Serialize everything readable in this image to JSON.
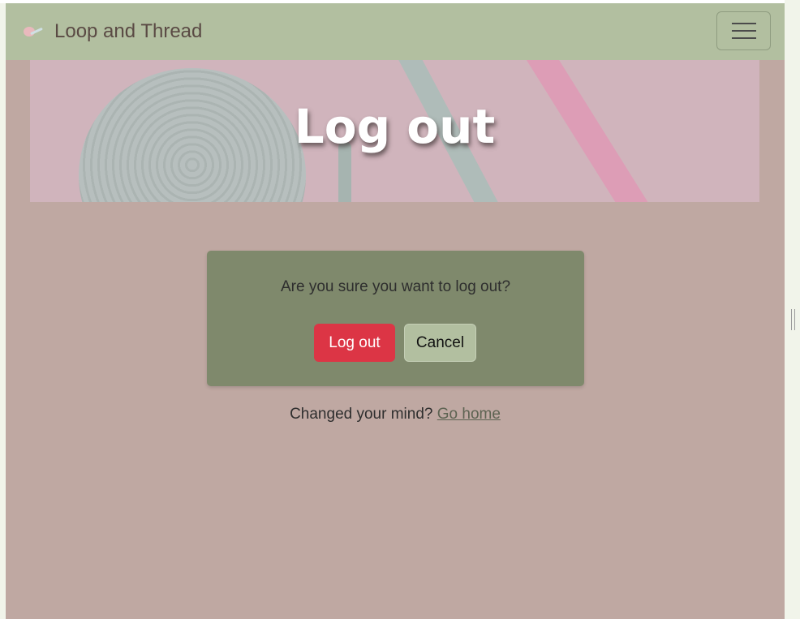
{
  "navbar": {
    "brand_name": "Loop and Thread"
  },
  "hero": {
    "title": "Log out"
  },
  "confirm": {
    "question": "Are you sure you want to log out?",
    "logout_label": "Log out",
    "cancel_label": "Cancel"
  },
  "footer": {
    "prompt": "Changed your mind?",
    "link_label": "Go home"
  },
  "colors": {
    "page_background": "#bfa8a2",
    "navbar": "#b2bfa0",
    "card": "#7f896c",
    "danger_button": "#dc3545",
    "secondary_button": "#b2bfa0"
  },
  "icons": {
    "brand": "yarn-logo-icon",
    "menu": "hamburger-menu-icon"
  }
}
